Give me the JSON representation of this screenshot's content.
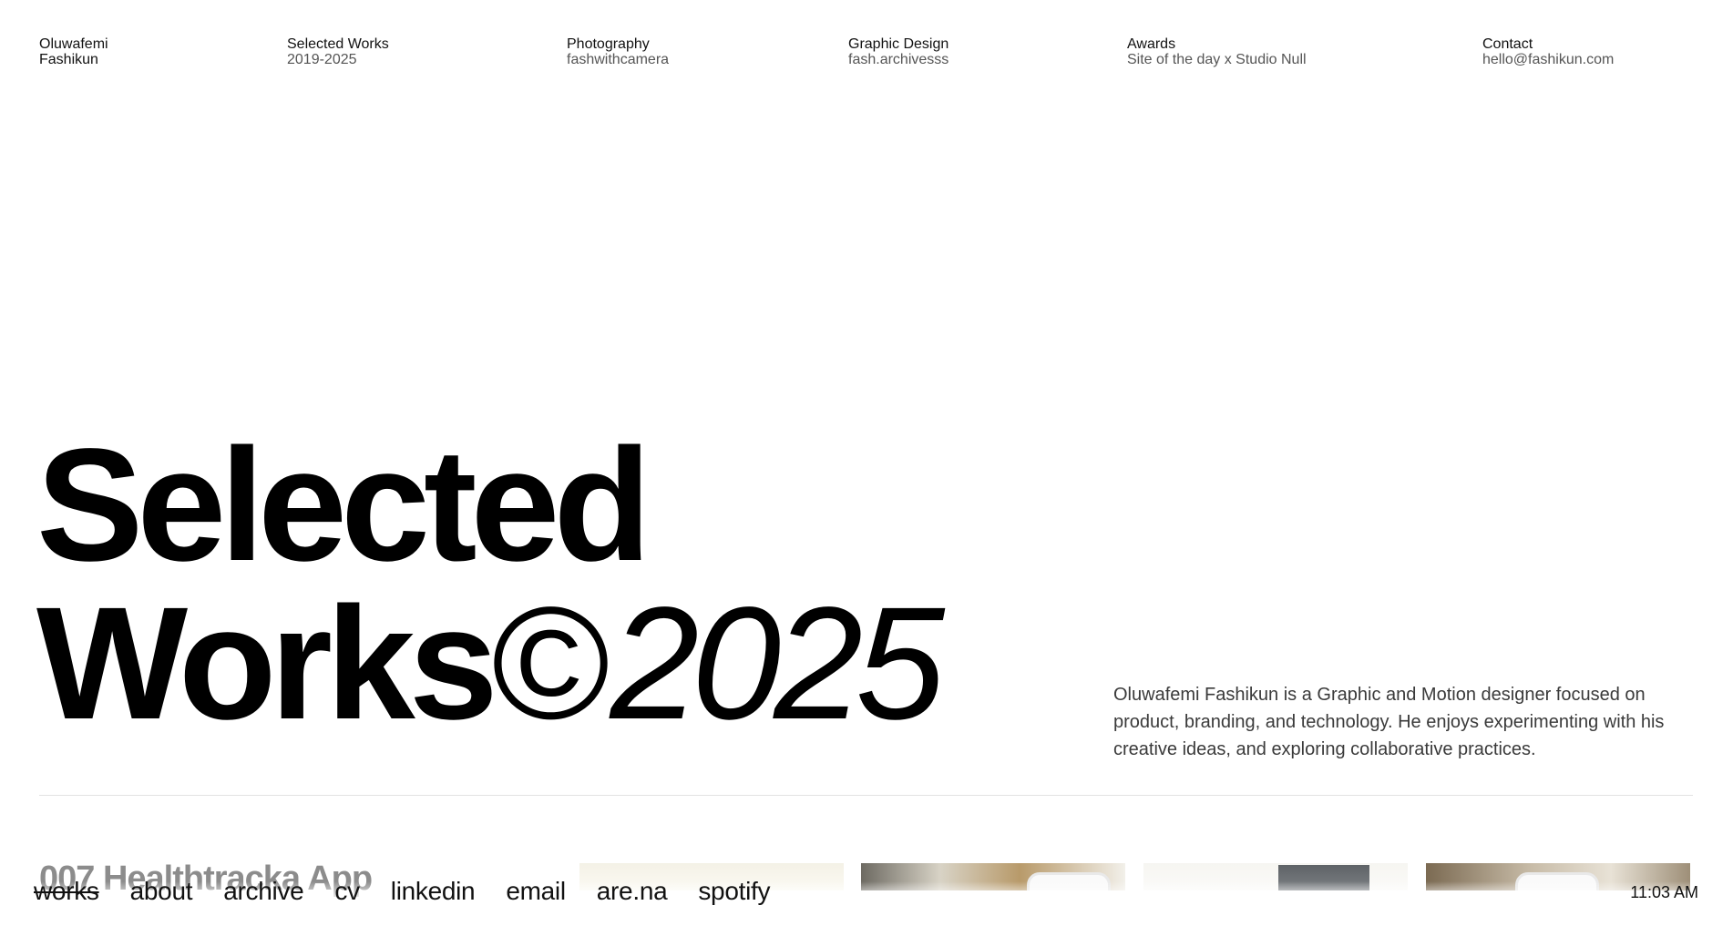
{
  "header": {
    "name": {
      "line1": "Oluwafemi",
      "line2": "Fashikun"
    },
    "columns": [
      {
        "label": "Selected Works",
        "value": "2019-2025"
      },
      {
        "label": "Photography",
        "value": "fashwithcamera"
      },
      {
        "label": "Graphic Design",
        "value": "fash.archivesss"
      },
      {
        "label": "Awards",
        "value": "Site of the day x Studio Null"
      },
      {
        "label": "Contact",
        "value": "hello@fashikun.com"
      }
    ]
  },
  "hero": {
    "line1": "Selected",
    "line2_word": "Works",
    "line2_symbol": "©",
    "line2_year": "2025"
  },
  "intro": "Oluwafemi Fashikun is a Graphic and Motion designer focused on product, branding, and technology. He enjoys experimenting with his creative ideas, and exploring collaborative practices.",
  "works": {
    "current_title": "007 Healthtracka App"
  },
  "nav": {
    "items": [
      "works",
      "about",
      "archive",
      "cv",
      "linkedin",
      "email",
      "are.na",
      "spotify"
    ],
    "active": "works"
  },
  "clock": "11:03 AM"
}
